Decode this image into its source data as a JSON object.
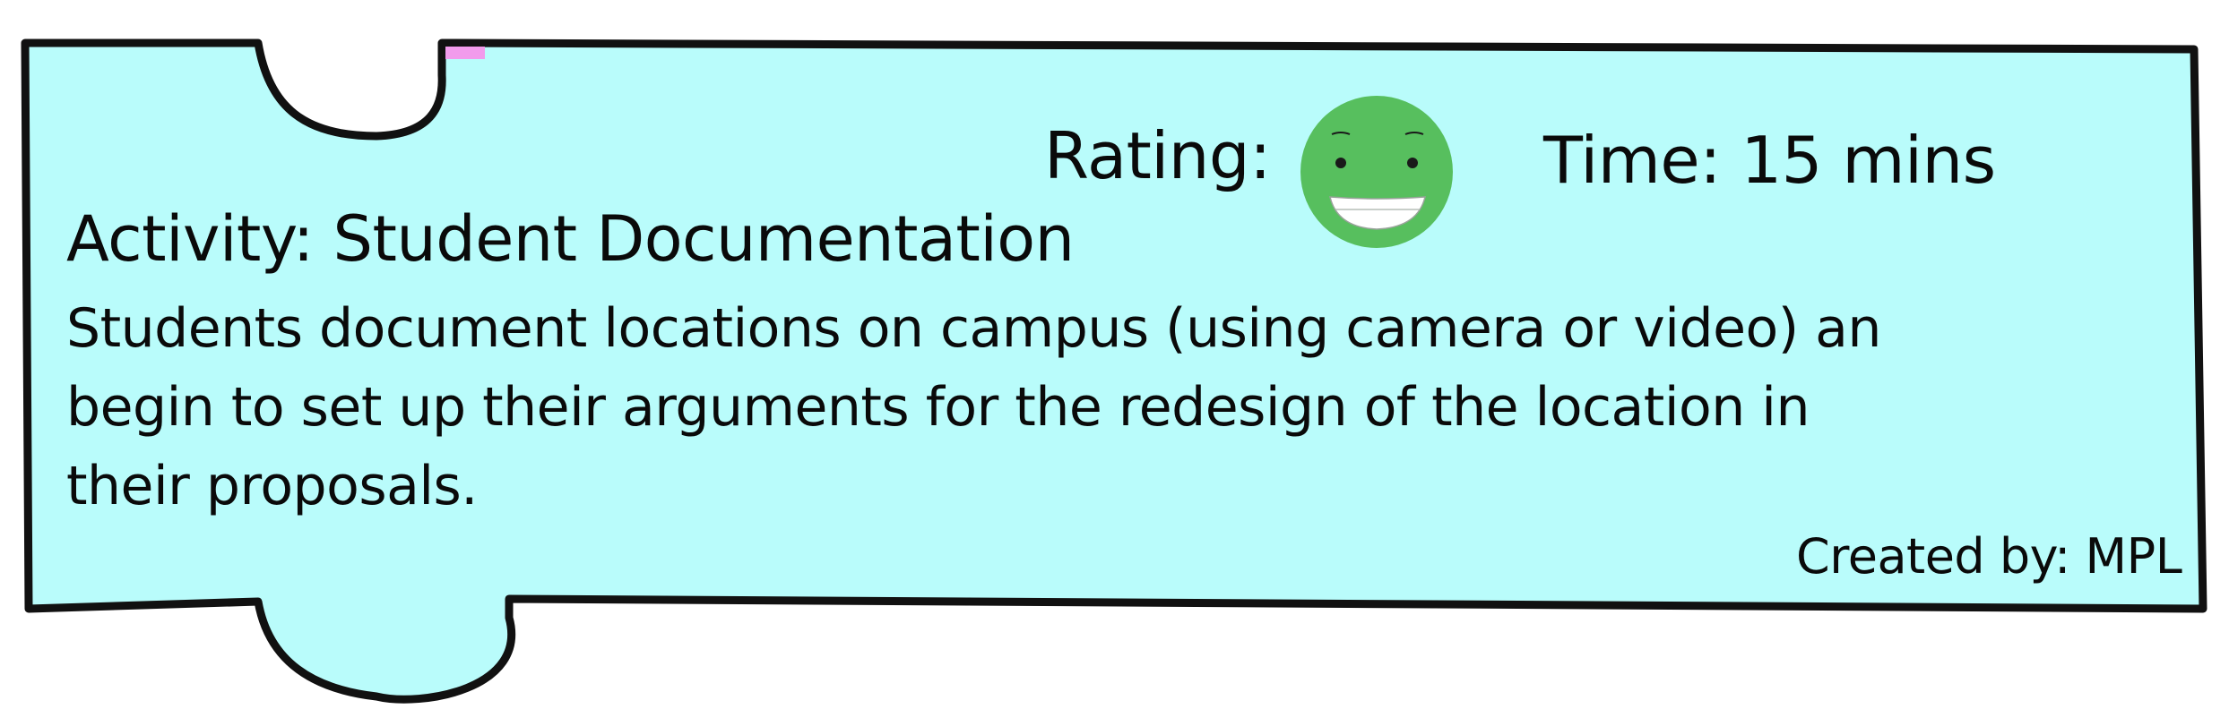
{
  "card": {
    "fill_color": "#b9fcfb",
    "outline_color": "#111111",
    "accent_tab_color": "#f29bec"
  },
  "rating": {
    "label": "Rating:",
    "icon": "smiley-face-icon",
    "face_color": "#57bf5e"
  },
  "time": {
    "label": "Time: 15 mins"
  },
  "activity": {
    "title": "Activity: Student Documentation",
    "description_lines": [
      "Students document locations on campus (using camera or video) an",
      "begin to set up their arguments for the redesign of the location in",
      "their proposals."
    ]
  },
  "credit": {
    "label": "Created by: MPL"
  }
}
